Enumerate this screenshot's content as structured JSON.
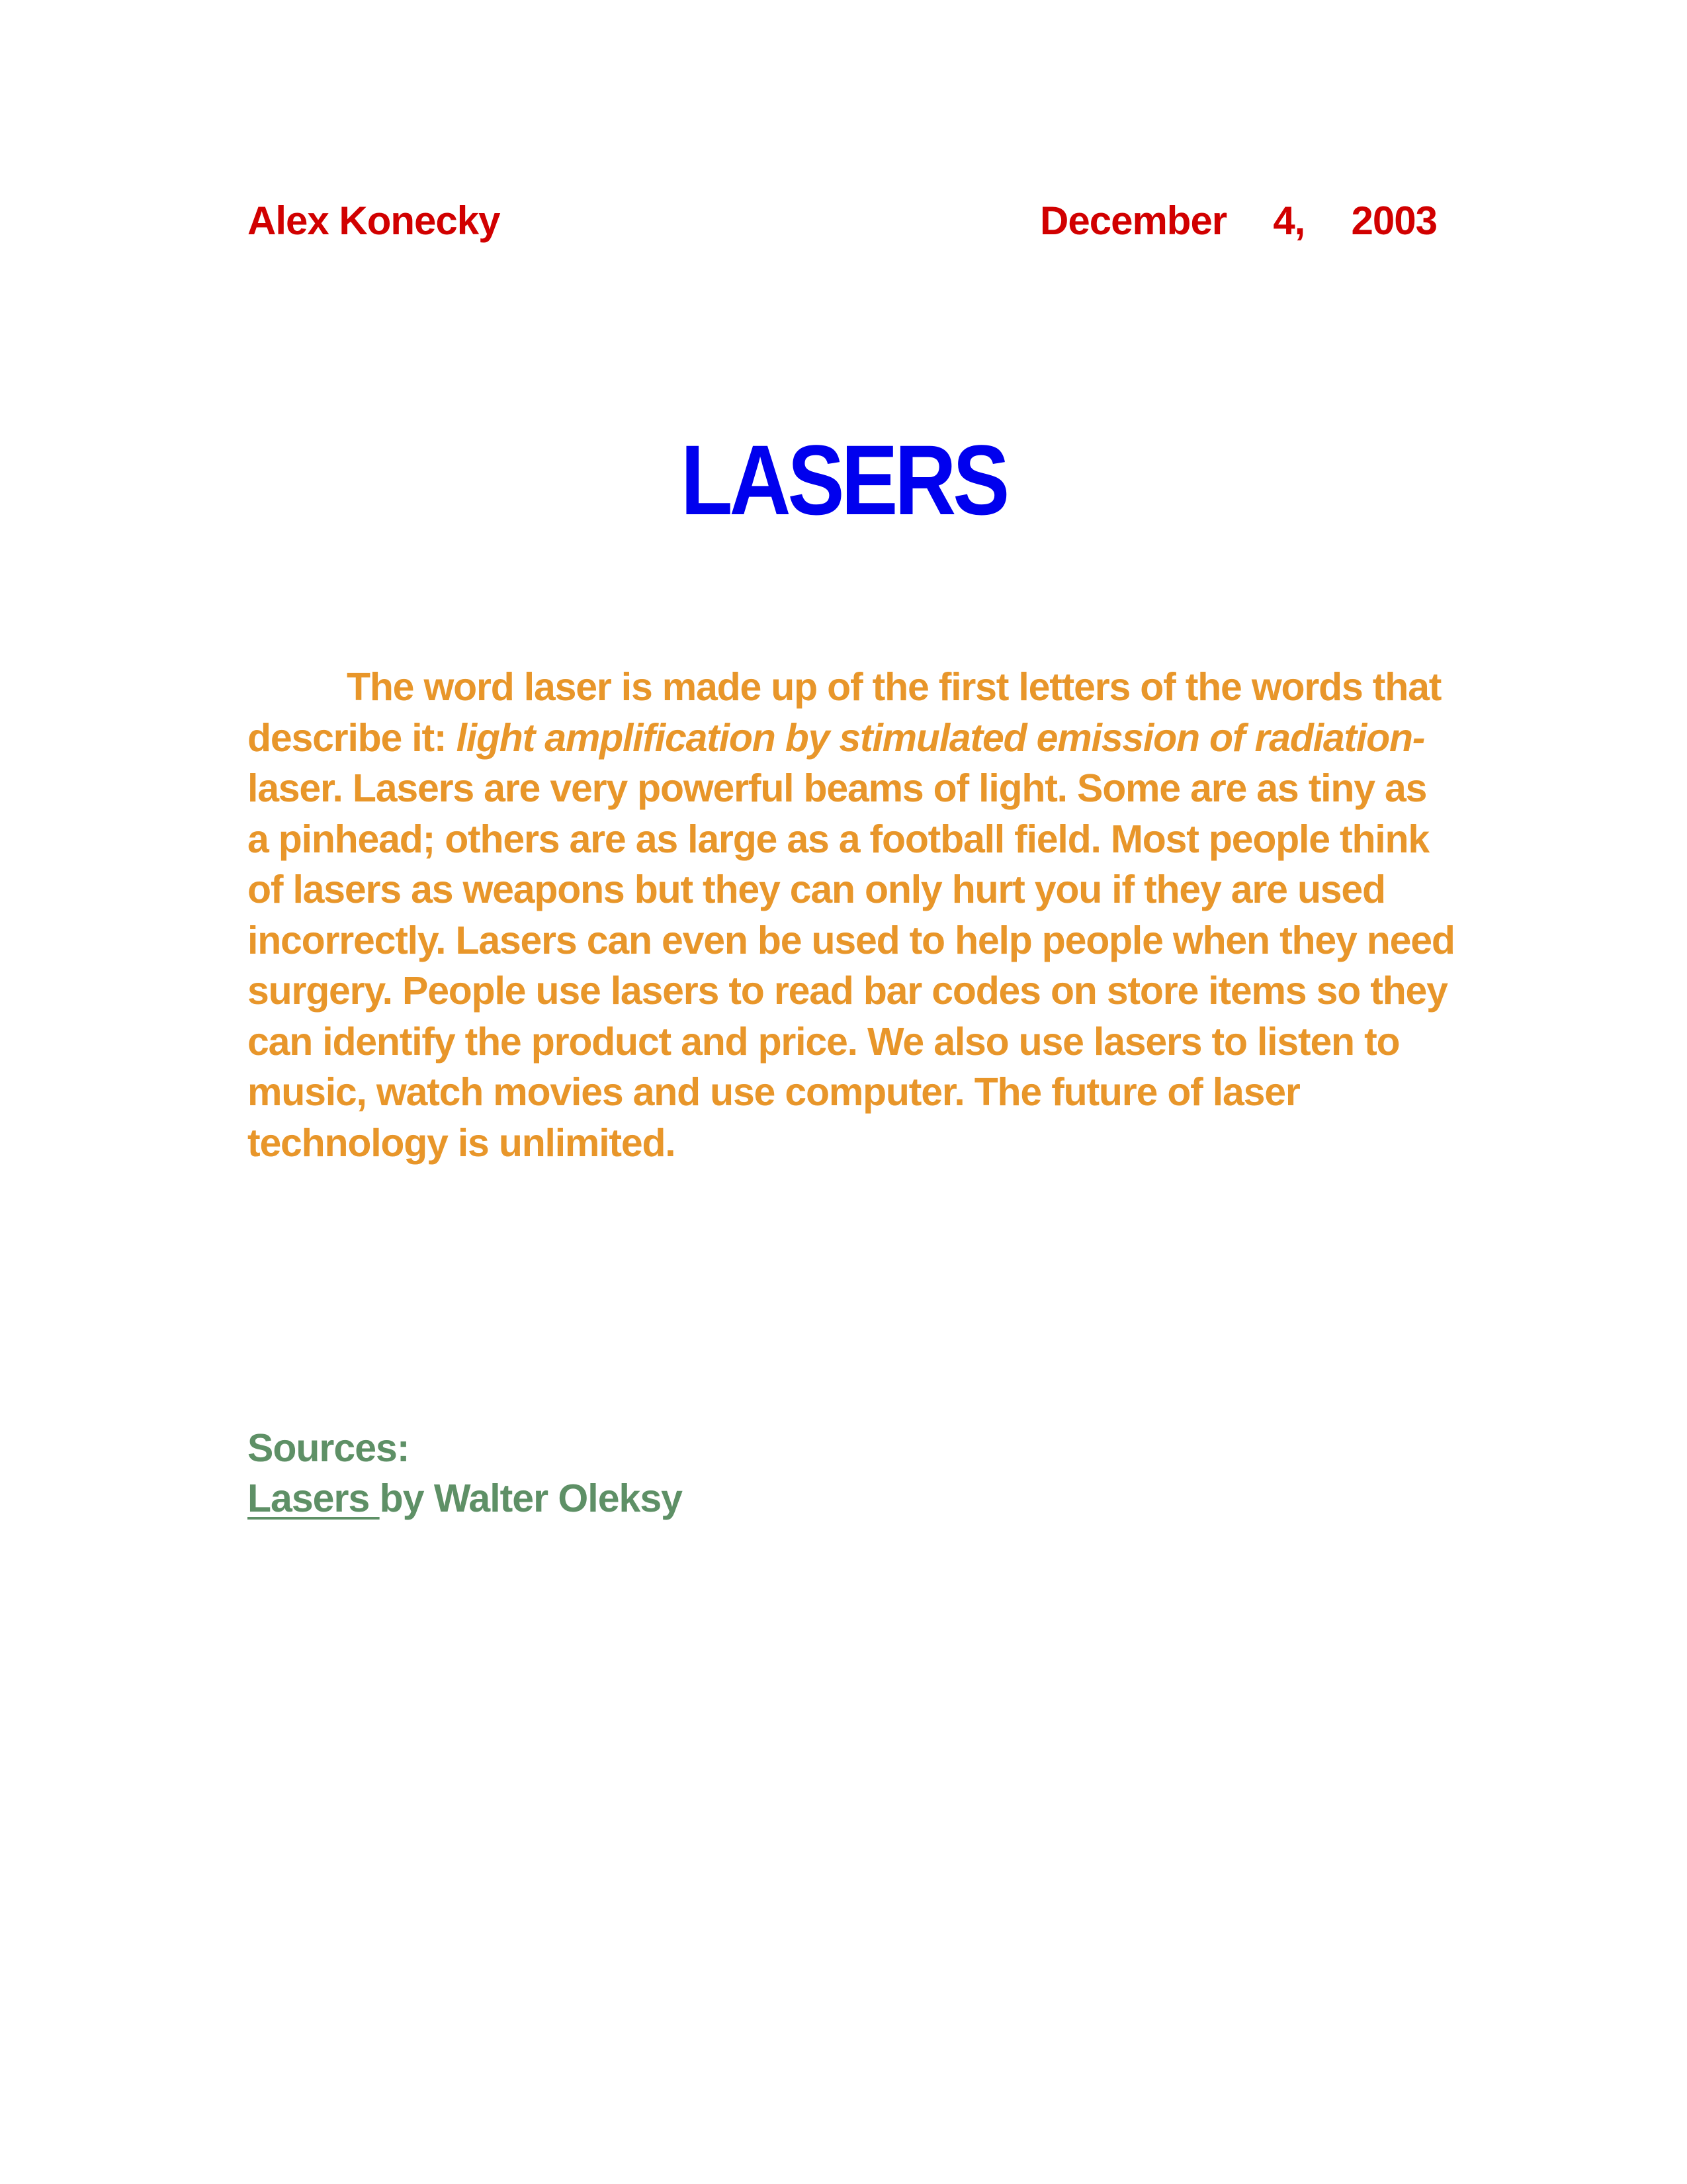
{
  "header": {
    "author": "Alex Konecky",
    "date_month": "December",
    "date_day": "4,",
    "date_year": "2003"
  },
  "title": "LASERS",
  "body": {
    "line1": "The word laser is made up of the first letters of the words that",
    "line2_prefix": "describe it: ",
    "line2_italic": "light amplification by stimulated emission of radiation-",
    "line3": "laser.  Lasers are very powerful beams of light.  Some are as tiny as",
    "line4": "a pinhead; others are as large as a football field.  Most people think",
    "line5": "of lasers as weapons but they can only hurt you if they are used",
    "line6": "incorrectly.  Lasers can even be used to help people when they need",
    "line7": "surgery.  People use lasers to read bar codes on store items so they",
    "line8": "can identify the product and price.  We also use lasers to listen to",
    "line9": "music, watch movies and use computer.  The future of laser",
    "line10": "technology is unlimited."
  },
  "sources": {
    "heading": "Sources:",
    "book_title": "Lasers ",
    "book_author": "by Walter Oleksy"
  },
  "colors": {
    "header": "#d10000",
    "title": "#0000ee",
    "body": "#e8962a",
    "sources": "#5e9066"
  }
}
